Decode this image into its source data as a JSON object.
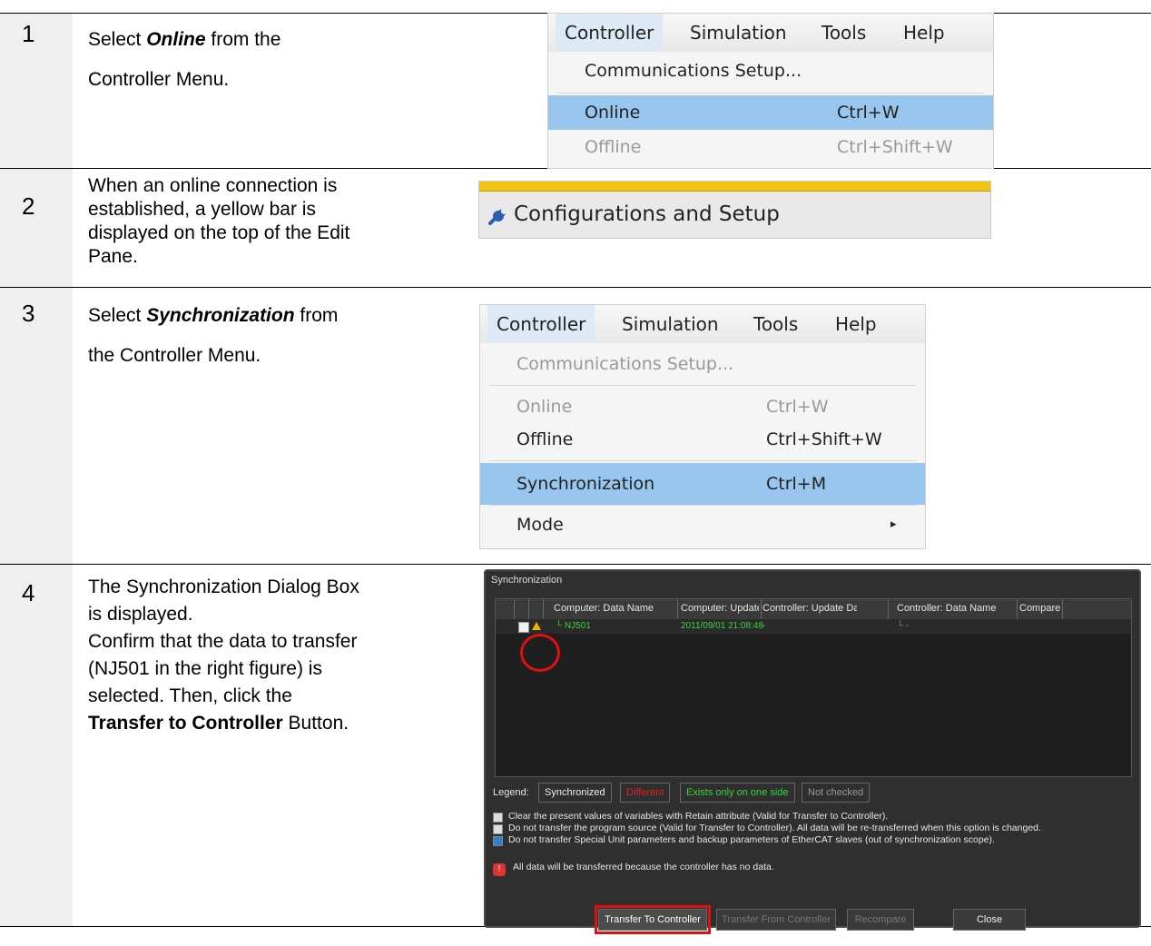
{
  "steps": [
    {
      "num": "1",
      "lines": [
        {
          "pre": "Select ",
          "em": "Online",
          "post": " from the"
        },
        {
          "text": "Controller Menu."
        }
      ]
    },
    {
      "num": "2",
      "lines": [
        {
          "text": "When an online connection is"
        },
        {
          "text": "established, a yellow bar is"
        },
        {
          "text": "displayed on the top of the Edit"
        },
        {
          "text": "Pane."
        }
      ]
    },
    {
      "num": "3",
      "lines": [
        {
          "pre": "Select ",
          "em": "Synchronization",
          "post": " from"
        },
        {
          "text": "the Controller Menu."
        }
      ]
    },
    {
      "num": "4",
      "lines": [
        {
          "text": "The Synchronization Dialog Box"
        },
        {
          "text": "is displayed."
        },
        {
          "text": "Confirm that the data to transfer"
        },
        {
          "text": "(NJ501 in the right figure) is"
        },
        {
          "text": "selected. Then, click the"
        },
        {
          "bold": "Transfer to Controller",
          "post": " Button."
        }
      ]
    }
  ],
  "menu1": {
    "bar": [
      "Controller",
      "Simulation",
      "Tools",
      "Help"
    ],
    "items": [
      {
        "label": "Communications Setup...",
        "shortcut": ""
      },
      {
        "label": "Online",
        "shortcut": "Ctrl+W"
      },
      {
        "label": "Offline",
        "shortcut": "Ctrl+Shift+W"
      }
    ]
  },
  "yellow_bar": {
    "label": "Configurations and Setup",
    "icon": "wrench-icon",
    "stripe_color": "#f1c40f"
  },
  "menu2": {
    "bar": [
      "Controller",
      "Simulation",
      "Tools",
      "Help"
    ],
    "items": [
      {
        "label": "Communications Setup...",
        "shortcut": ""
      },
      {
        "label": "Online",
        "shortcut": "Ctrl+W"
      },
      {
        "label": "Offline",
        "shortcut": "Ctrl+Shift+W"
      },
      {
        "label": "Synchronization",
        "shortcut": "Ctrl+M"
      },
      {
        "label": "Mode",
        "shortcut": "▸"
      }
    ]
  },
  "dialog": {
    "title": "Synchronization",
    "columns": [
      "Computer: Data Name",
      "Computer: Update Da",
      "Controller: Update Da",
      "Controller: Data Name",
      "Compare"
    ],
    "row": {
      "name": "└ NJ501",
      "computer_update": "2011/09/01 21:08:48",
      "controller_update": "-",
      "controller_name": "└ -",
      "compare": ""
    },
    "legend_label": "Legend:",
    "legend": [
      "Synchronized",
      "Different",
      "Exists only on one side",
      "Not checked"
    ],
    "options": [
      {
        "text": "Clear the present values of variables with Retain attribute (Valid for Transfer to Controller).",
        "checked": false
      },
      {
        "text": "Do not transfer the program source (Valid for Transfer to Controller). All data will be re-transferred when this option is changed.",
        "checked": false
      },
      {
        "text": "Do not transfer Special Unit parameters and backup parameters of EtherCAT slaves (out of synchronization scope).",
        "checked": true
      }
    ],
    "info": "All data will be transferred because the controller has no data.",
    "buttons": [
      "Transfer To Controller",
      "Transfer From Controller",
      "Recompare",
      "Close"
    ]
  }
}
